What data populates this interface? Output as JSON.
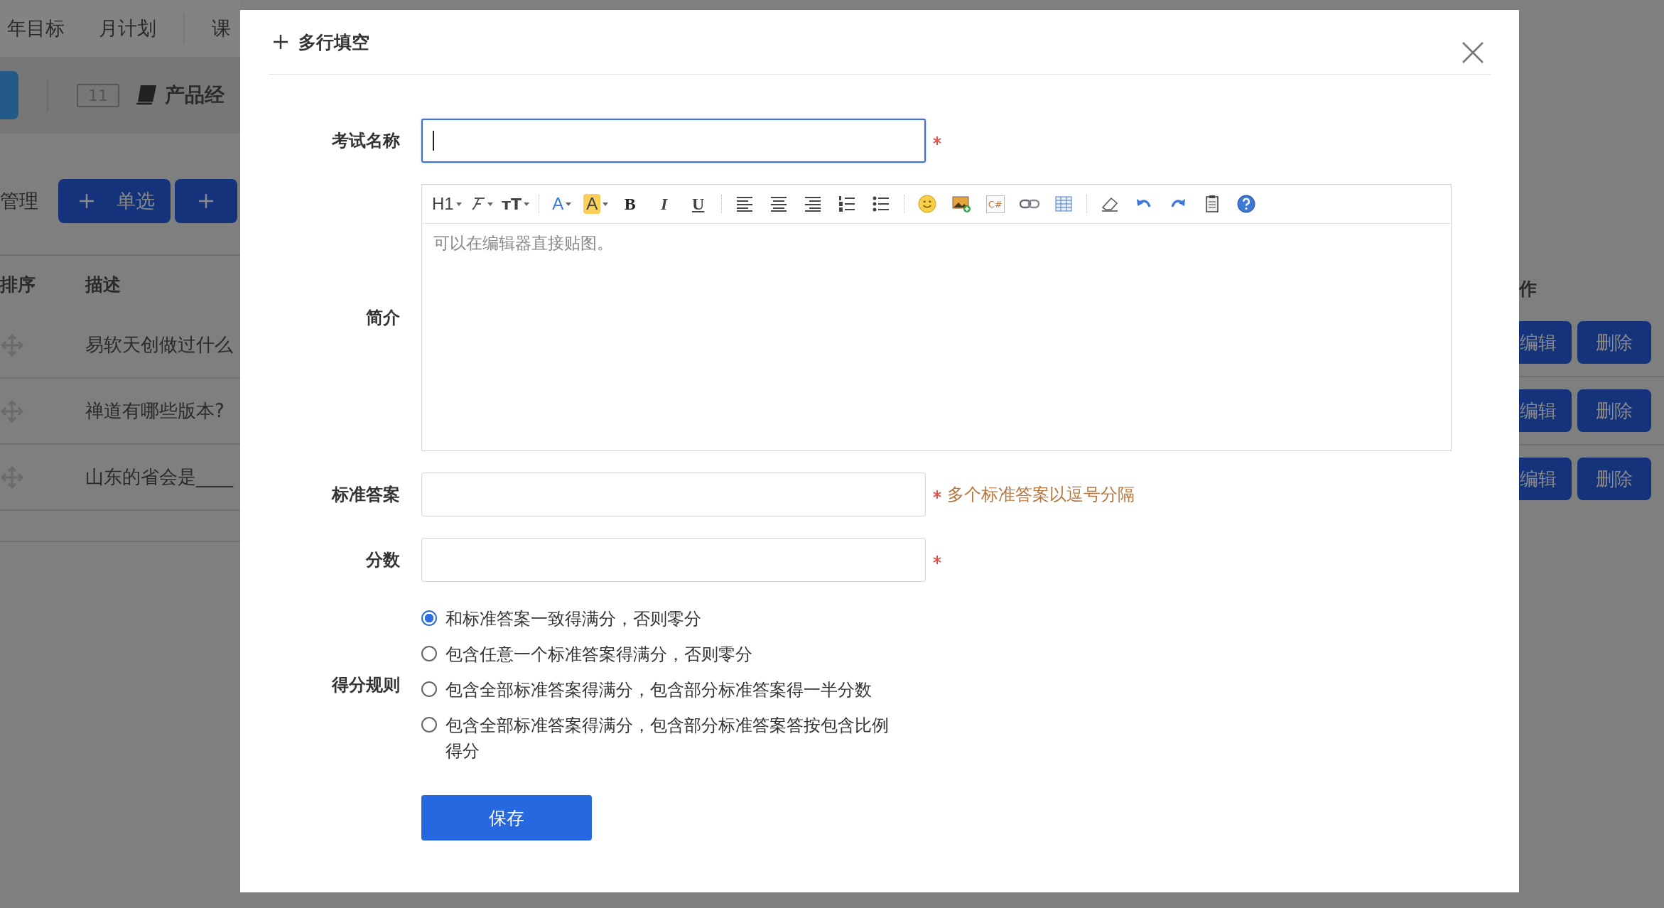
{
  "background": {
    "nav_tabs": [
      "年目标",
      "月计划",
      "课"
    ],
    "course": {
      "count": "11",
      "title": "产品经"
    },
    "section_label": "管理",
    "add_buttons": [
      {
        "kind": "add",
        "label": "单选"
      },
      {
        "kind": "add"
      }
    ],
    "table": {
      "columns": [
        "排序",
        "描述"
      ],
      "actions_column": "作",
      "rows": [
        {
          "description": "易软天创做过什么",
          "edit": "编辑",
          "delete": "删除"
        },
        {
          "description": "禅道有哪些版本?",
          "edit": "编辑",
          "delete": "删除"
        },
        {
          "description": "山东的省会是____",
          "edit": "编辑",
          "delete": "删除"
        }
      ]
    }
  },
  "dialog": {
    "title": "多行填空",
    "fields": [
      {
        "label": "考试名称",
        "kind": "input",
        "focused": true,
        "required": true
      },
      {
        "label": "简介",
        "kind": "editor",
        "placeholder": "可以在编辑器直接贴图。"
      },
      {
        "label": "标准答案",
        "kind": "input",
        "focused": false,
        "required": true,
        "hint": "多个标准答案以逗号分隔"
      },
      {
        "label": "分数",
        "kind": "input",
        "focused": false,
        "required": true
      }
    ],
    "toolbar": [
      {
        "kind": "heading",
        "label": "H1"
      },
      {
        "kind": "font"
      },
      {
        "kind": "size",
        "label": "ᴛT"
      },
      {
        "kind": "sep"
      },
      {
        "kind": "color",
        "label": "A"
      },
      {
        "kind": "highlight",
        "label": "A"
      },
      {
        "kind": "bold",
        "label": "B"
      },
      {
        "kind": "italic",
        "label": "I"
      },
      {
        "kind": "underline",
        "label": "U"
      },
      {
        "kind": "sep"
      },
      {
        "kind": "align-left"
      },
      {
        "kind": "align-center"
      },
      {
        "kind": "align-right"
      },
      {
        "kind": "ordered-list"
      },
      {
        "kind": "bullet-list"
      },
      {
        "kind": "sep"
      },
      {
        "kind": "emoji"
      },
      {
        "kind": "image"
      },
      {
        "kind": "code",
        "label": "C#"
      },
      {
        "kind": "link"
      },
      {
        "kind": "table"
      },
      {
        "kind": "sep"
      },
      {
        "kind": "eraser"
      },
      {
        "kind": "undo"
      },
      {
        "kind": "redo"
      },
      {
        "kind": "paste"
      },
      {
        "kind": "help"
      }
    ],
    "scoring": {
      "label": "得分规则",
      "options": [
        {
          "text": "和标准答案一致得满分，否则零分",
          "selected": true
        },
        {
          "text": "包含任意一个标准答案得满分，否则零分",
          "selected": false
        },
        {
          "text": "包含全部标准答案得满分，包含部分标准答案得一半分数",
          "selected": false
        },
        {
          "text": "包含全部标准答案得满分，包含部分标准答案答按包含比例得分",
          "selected": false
        }
      ]
    },
    "save_button": "保存"
  }
}
